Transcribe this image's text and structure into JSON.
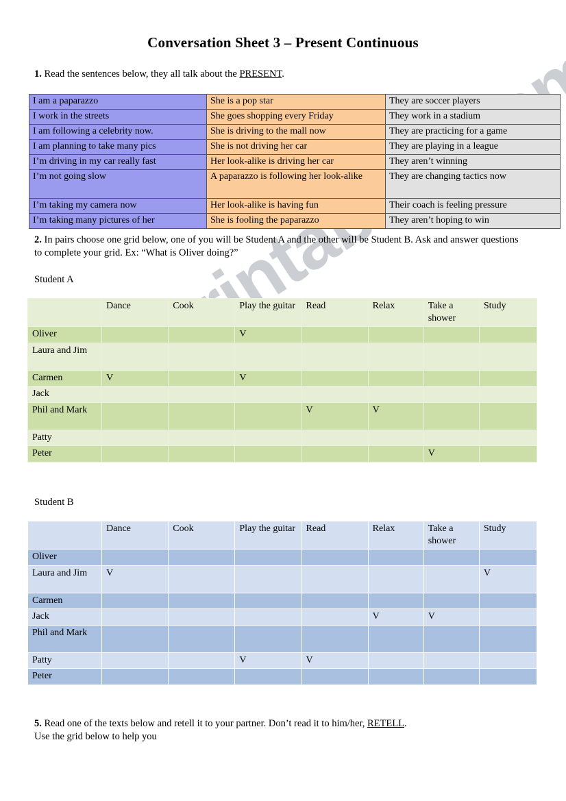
{
  "document": {
    "title": "Conversation Sheet 3 – Present Continuous",
    "watermark": "ESLprintables.com"
  },
  "instructions": {
    "task1_prefix": "1.",
    "task1_text": " Read the sentences below, they all talk about the ",
    "task1_underlined": "PRESENT",
    "task1_suffix": ".",
    "task2_prefix": "2.",
    "task2_text": "  In pairs choose one grid below, one of you will be Student A and the other will be Student B. Ask and answer questions to complete your grid. Ex: “What is Oliver doing?”",
    "task5_prefix": "5.",
    "task5_text": " Read one of the texts below and retell it to your partner. Don’t read it to him/her, ",
    "task5_underlined": "RETELL",
    "task5_suffix": ".",
    "task5_line2": "Use the grid below to help you",
    "student_a_label": "Student A",
    "student_b_label": "Student B"
  },
  "sentence_table": {
    "colors": {
      "column1": "#9a9aef",
      "column2": "#fbcb9a",
      "column3": "#e1e1e1"
    },
    "rows": [
      [
        "I am a paparazzo",
        "She is a pop star",
        "They are soccer players"
      ],
      [
        "I work in the streets",
        "She goes shopping every Friday",
        "They work in a stadium"
      ],
      [
        "I am following a celebrity now.",
        "She is driving to the mall now",
        "They are practicing for a game"
      ],
      [
        "I am planning to take many pics",
        "She is not driving her car",
        "They are playing in a league"
      ],
      [
        "I’m driving in my car really fast",
        "Her look-alike is driving her car",
        "They aren’t winning"
      ],
      [
        "I’m not going slow",
        "A paparazzo is following her look-alike",
        "They are changing tactics now"
      ],
      [
        "I’m taking my camera now",
        "Her look-alike is having fun",
        "Their coach is feeling pressure"
      ],
      [
        "I’m taking many pictures of her",
        "She is fooling the paparazzo",
        "They aren’t hoping to win"
      ]
    ]
  },
  "grid_a": {
    "accent": "#cddfa8",
    "headers": [
      "",
      "Dance",
      "Cook",
      "Play the guitar",
      "Read",
      "Relax",
      "Take a shower",
      "Study"
    ],
    "rows": [
      {
        "name": "Oliver",
        "marks": [
          "",
          "",
          "V",
          "",
          "",
          "",
          ""
        ]
      },
      {
        "name": "Laura and Jim",
        "marks": [
          "",
          "",
          "",
          "",
          "",
          "",
          ""
        ]
      },
      {
        "name": "Carmen",
        "marks": [
          "V",
          "",
          "V",
          "",
          "",
          "",
          ""
        ]
      },
      {
        "name": "Jack",
        "marks": [
          "",
          "",
          "",
          "",
          "",
          "",
          ""
        ]
      },
      {
        "name": "Phil and Mark",
        "marks": [
          "",
          "",
          "",
          "V",
          "V",
          "",
          ""
        ]
      },
      {
        "name": "Patty",
        "marks": [
          "",
          "",
          "",
          "",
          "",
          "",
          ""
        ]
      },
      {
        "name": "Peter",
        "marks": [
          "",
          "",
          "",
          "",
          "",
          "V",
          ""
        ]
      }
    ]
  },
  "grid_b": {
    "accent": "#a9c0e0",
    "headers": [
      "",
      "Dance",
      "Cook",
      "Play the guitar",
      "Read",
      "Relax",
      "Take a shower",
      "Study"
    ],
    "rows": [
      {
        "name": "Oliver",
        "marks": [
          "",
          "",
          "",
          "",
          "",
          "",
          ""
        ]
      },
      {
        "name": "Laura and Jim",
        "marks": [
          "V",
          "",
          "",
          "",
          "",
          "",
          "V"
        ]
      },
      {
        "name": "Carmen",
        "marks": [
          "",
          "",
          "",
          "",
          "",
          "",
          ""
        ]
      },
      {
        "name": "Jack",
        "marks": [
          "",
          "",
          "",
          "",
          "V",
          "V",
          ""
        ]
      },
      {
        "name": "Phil and Mark",
        "marks": [
          "",
          "",
          "",
          "",
          "",
          "",
          ""
        ]
      },
      {
        "name": "Patty",
        "marks": [
          "",
          "",
          "V",
          "V",
          "",
          "",
          ""
        ]
      },
      {
        "name": "Peter",
        "marks": [
          "",
          "",
          "",
          "",
          "",
          "",
          ""
        ]
      }
    ]
  }
}
